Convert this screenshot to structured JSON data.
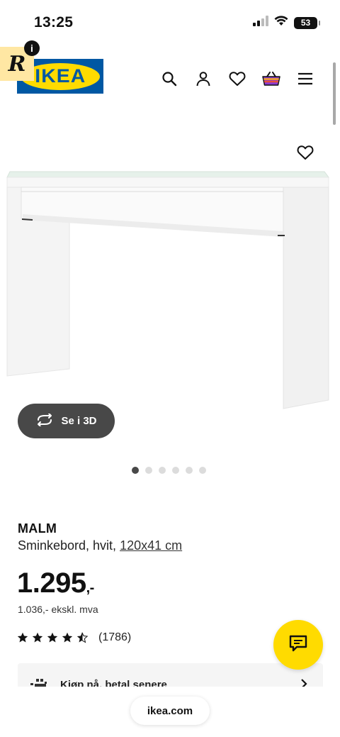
{
  "status_bar": {
    "time": "13:25",
    "battery": "53"
  },
  "header": {
    "logo_text": "IKEA",
    "badge_letter": "R",
    "badge_info": "i",
    "icons": [
      "search-icon",
      "user-icon",
      "heart-icon",
      "basket-icon",
      "menu-icon"
    ]
  },
  "gallery": {
    "view_3d_label": "Se i 3D",
    "dots_total": 6,
    "active_dot": 0
  },
  "product": {
    "name": "MALM",
    "description": "Sminkebord, hvit,",
    "dimensions": "120x41 cm",
    "price": "1.295",
    "price_suffix": ",-",
    "price_ex_vat": "1.036,- ekskl. mva",
    "rating": 4.5,
    "rating_count": "(1786)"
  },
  "pay_later": {
    "label": "Kjøp nå, betal senere"
  },
  "browser": {
    "url": "ikea.com"
  },
  "colors": {
    "ikea_blue": "#0058a3",
    "ikea_yellow": "#ffdb00",
    "pill_dark": "#484848"
  }
}
